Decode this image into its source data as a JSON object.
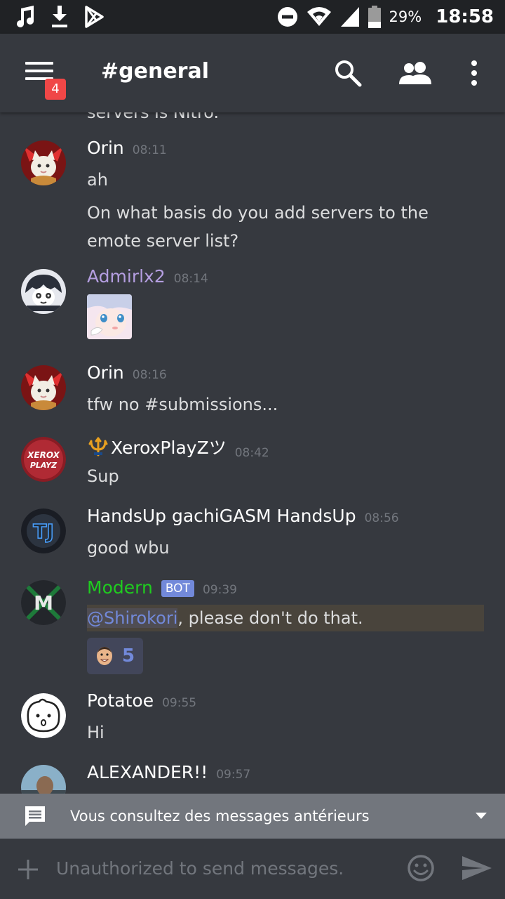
{
  "status_bar": {
    "battery_percent": "29%",
    "time": "18:58",
    "icons": [
      "music-note-icon",
      "download-icon",
      "play-store-icon",
      "do-not-disturb-icon",
      "wifi-icon",
      "signal-icon",
      "battery-icon"
    ]
  },
  "header": {
    "menu_badge": "4",
    "channel": "#general",
    "icons": [
      "menu-icon",
      "search-icon",
      "members-icon",
      "overflow-icon"
    ]
  },
  "partial_text": "servers is Nitro.",
  "messages": [
    {
      "user": "Orin",
      "time": "08:11",
      "lines": [
        "ah",
        "On what basis do you add servers to the emote server list?"
      ]
    },
    {
      "user": "Admirlx2",
      "time": "08:14",
      "attachment": "anime-sticker-image"
    },
    {
      "user": "Orin",
      "time": "08:16",
      "lines": [
        "tfw no #submissions..."
      ]
    },
    {
      "user": "XeroxPlayZツ",
      "time": "08:42",
      "lines": [
        "Sup"
      ]
    },
    {
      "user": "HandsUp gachiGASM HandsUp",
      "time": "08:56",
      "lines": [
        "good wbu"
      ]
    },
    {
      "user": "Modern",
      "bot_tag": "BOT",
      "time": "09:39",
      "mention": "@Shirokori",
      "mention_rest": ", please don't do that.",
      "reaction_count": "5"
    },
    {
      "user": "Potatoe",
      "time": "09:55",
      "lines": [
        "Hi"
      ]
    },
    {
      "user": "ALEXANDER!!",
      "time": "09:57"
    }
  ],
  "colors": {
    "background": "#36393f",
    "admirlx2": "#b49ee0",
    "modern": "#1fcc1f",
    "bot_tag": "#7289da",
    "badge": "#f04747",
    "mention": "#7289da"
  },
  "banner": {
    "text": "Vous consultez des messages antérieurs"
  },
  "input": {
    "placeholder": "Unauthorized to send messages."
  }
}
